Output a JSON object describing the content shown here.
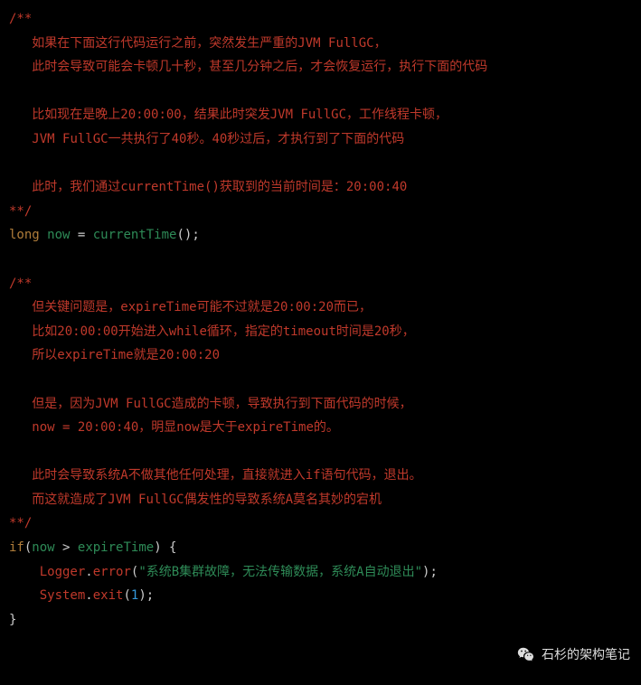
{
  "code": {
    "comment1": {
      "open": "/**",
      "l1": "   如果在下面这行代码运行之前，突然发生严重的JVM FullGC，",
      "l2": "   此时会导致可能会卡顿几十秒，甚至几分钟之后，才会恢复运行，执行下面的代码",
      "l3": "",
      "l4": "   比如现在是晚上20:00:00，结果此时突发JVM FullGC，工作线程卡顿，",
      "l5": "   JVM FullGC一共执行了40秒。40秒过后，才执行到了下面的代码",
      "l6": "",
      "l7": "   此时，我们通过currentTime()获取到的当前时间是：20:00:40",
      "close": "**/"
    },
    "line1": {
      "kw": "long",
      "var": "now",
      "eq": " = ",
      "fn": "currentTime",
      "tail": "();"
    },
    "comment2": {
      "open": "/**",
      "l1": "   但关键问题是，expireTime可能不过就是20:00:20而已，",
      "l2": "   比如20:00:00开始进入while循环，指定的timeout时间是20秒，",
      "l3": "   所以expireTime就是20:00:20",
      "l4": "",
      "l5": "   但是，因为JVM FullGC造成的卡顿，导致执行到下面代码的时候，",
      "l6": "   now = 20:00:40，明显now是大于expireTime的。",
      "l7": "",
      "l8": "   此时会导致系统A不做其他任何处理，直接就进入if语句代码，退出。",
      "l9": "   而这就造成了JVM FullGC偶发性的导致系统A莫名其妙的宕机",
      "close": "**/"
    },
    "ifline": {
      "kw": "if",
      "open": "(",
      "v1": "now",
      "op": " > ",
      "v2": "expireTime",
      "close": ") {"
    },
    "logline": {
      "indent": "    ",
      "obj": "Logger",
      "dot": ".",
      "method": "error",
      "open": "(",
      "str": "\"系统B集群故障，无法传输数据，系统A自动退出\"",
      "close": ");"
    },
    "exitline": {
      "indent": "    ",
      "obj": "System",
      "dot": ".",
      "method": "exit",
      "open": "(",
      "num": "1",
      "close": ");"
    },
    "brace": "}"
  },
  "watermark": {
    "text": "石杉的架构笔记"
  }
}
